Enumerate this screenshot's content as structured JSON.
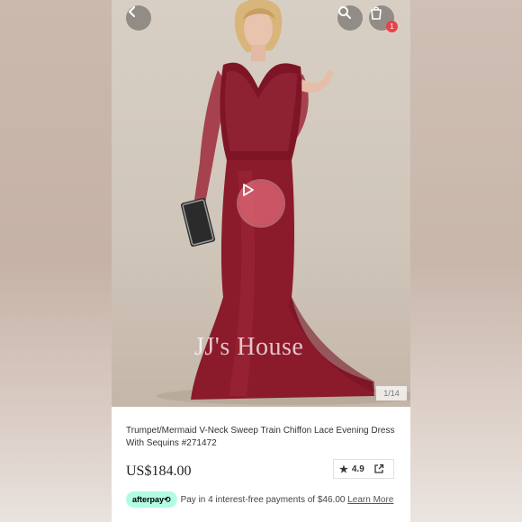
{
  "header": {
    "back_icon": "chevron-left-icon",
    "search_icon": "search-icon",
    "cart_icon": "shopping-bag-icon",
    "cart_count": "1"
  },
  "gallery": {
    "watermark": "JJ's House",
    "counter": "1/14",
    "play_icon": "play-icon"
  },
  "product": {
    "title": "Trumpet/Mermaid V-Neck Sweep Train Chiffon Lace Evening Dress With Sequins  #271472",
    "price": "US$184.00",
    "rating": "4.9",
    "star_icon": "star-icon",
    "share_icon": "share-icon"
  },
  "afterpay": {
    "badge": "afterpay⟲",
    "text": "Pay in 4 interest-free payments of $46.00 ",
    "link": "Learn More"
  },
  "colors": {
    "dress": "#8b1a2b",
    "badge": "#e8424a",
    "afterpay": "#b2fce4"
  }
}
